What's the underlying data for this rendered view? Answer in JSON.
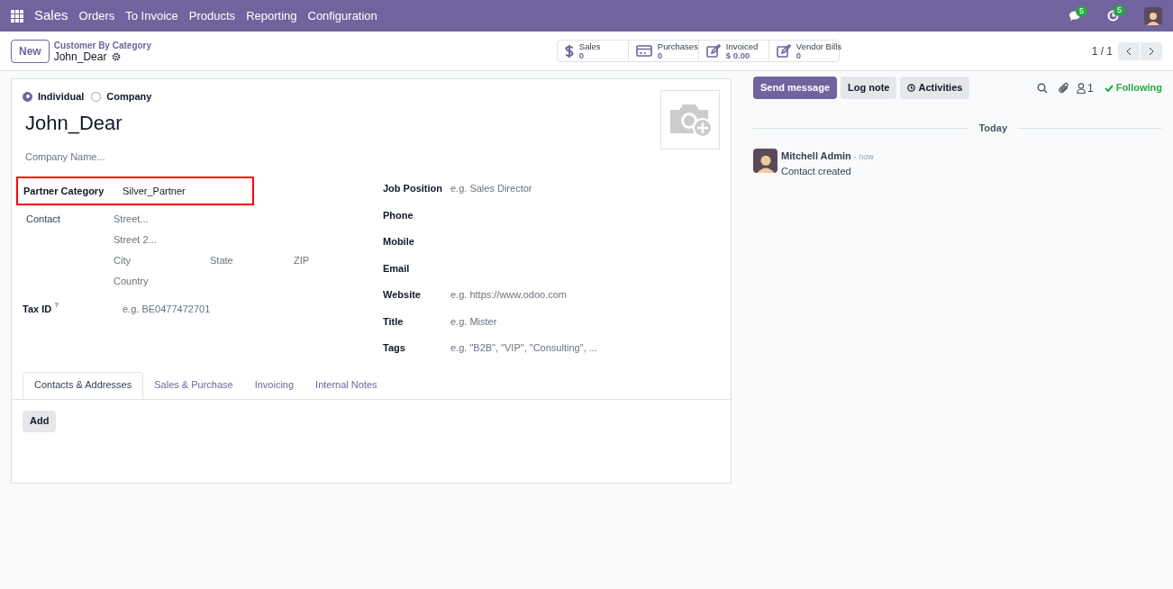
{
  "navbar": {
    "app": "Sales",
    "menu": [
      "Orders",
      "To Invoice",
      "Products",
      "Reporting",
      "Configuration"
    ],
    "chat_count": "5",
    "activity_count": "5"
  },
  "control_panel": {
    "new_button": "New",
    "breadcrumb": "Customer By Category",
    "record": "John_Dear",
    "pager": "1 / 1",
    "smart_buttons": [
      {
        "kind": "dollar",
        "label": "Sales",
        "value": "0"
      },
      {
        "kind": "card",
        "label": "Purchases",
        "value": "0"
      },
      {
        "kind": "edit",
        "label": "Invoiced",
        "value": "$ 0.00"
      },
      {
        "kind": "edit",
        "label": "Vendor Bills",
        "value": "0"
      }
    ]
  },
  "form": {
    "company_type": [
      {
        "label": "Individual",
        "selected": true
      },
      {
        "label": "Company",
        "selected": false
      }
    ],
    "name": "John_Dear",
    "company_placeholder": "Company Name...",
    "partner_category": {
      "label": "Partner Category",
      "value": "Silver_Partner"
    },
    "address": {
      "label": "Contact",
      "street": "Street...",
      "street2": "Street 2...",
      "city": "City",
      "state": "State",
      "zip": "ZIP",
      "country": "Country"
    },
    "tax_id": {
      "label": "Tax ID",
      "help": "?",
      "placeholder": "e.g. BE0477472701"
    },
    "right_fields": [
      {
        "label": "Job Position",
        "placeholder": "e.g. Sales Director"
      },
      {
        "label": "Phone"
      },
      {
        "label": "Mobile"
      },
      {
        "label": "Email"
      },
      {
        "label": "Website",
        "placeholder": "e.g. https://www.odoo.com"
      },
      {
        "label": "Title",
        "placeholder": "e.g. Mister"
      },
      {
        "label": "Tags",
        "placeholder": "e.g. \"B2B\", \"VIP\", \"Consulting\", ..."
      }
    ],
    "tabs": [
      {
        "label": "Contacts & Addresses",
        "selected": true
      },
      {
        "label": "Sales & Purchase",
        "selected": false
      },
      {
        "label": "Invoicing",
        "selected": false
      },
      {
        "label": "Internal Notes",
        "selected": false
      }
    ],
    "add_button": "Add"
  },
  "chatter": {
    "buttons": [
      {
        "kind": "primary",
        "label": "Send message"
      },
      {
        "kind": "secondary",
        "label": "Log note"
      },
      {
        "kind": "clock",
        "label": "Activities"
      }
    ],
    "followers": "1",
    "following": "Following",
    "date": "Today",
    "messages": [
      {
        "author": "Mitchell Admin",
        "time": "- now",
        "body": "Contact created"
      }
    ]
  }
}
